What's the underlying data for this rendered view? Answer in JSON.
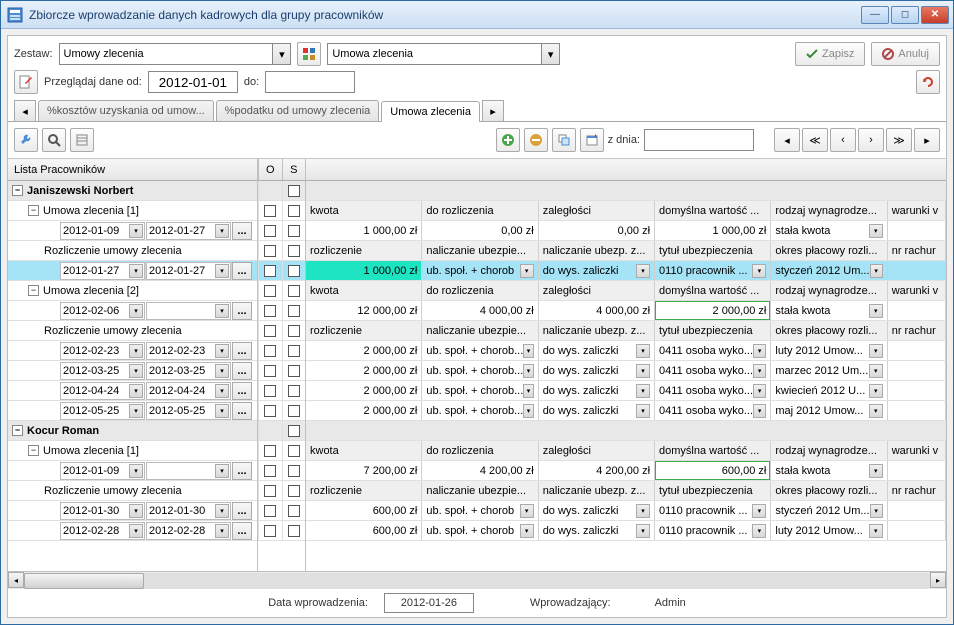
{
  "window": {
    "title": "Zbiorcze wprowadzanie danych kadrowych dla grupy pracowników"
  },
  "top": {
    "set_label": "Zestaw:",
    "set_value": "Umowy zlecenia",
    "set2_value": "Umowa zlecenia",
    "save": "Zapisz",
    "cancel": "Anuluj",
    "browse_label": "Przeglądaj dane od:",
    "date_from": "2012-01-01",
    "date_to_label": "do:",
    "date_to": ""
  },
  "tabs": {
    "items": [
      "%kosztów uzyskania od umow...",
      "%podatku od umowy zlecenia",
      "Umowa zlecenia"
    ],
    "active": 2
  },
  "toolbar": {
    "from_date_label": "z dnia:",
    "from_date": ""
  },
  "grid": {
    "left_header": "Lista Pracowników",
    "mid_headers": [
      "O",
      "S"
    ],
    "emp1": {
      "name": "Janiszewski Norbert"
    },
    "uz1": "Umowa zlecenia [1]",
    "uz1_hdr": [
      "kwota",
      "do rozliczenia",
      "zaległości",
      "domyślna wartość ...",
      "rodzaj wynagrodze...",
      "warunki v"
    ],
    "uz1_r1": {
      "d1": "2012-01-09",
      "d2": "2012-01-27",
      "c0": "1 000,00 zł",
      "c1": "0,00 zł",
      "c2": "0,00 zł",
      "c3": "1 000,00 zł",
      "c4": "stała kwota"
    },
    "ruz1_lbl": "Rozliczenie umowy zlecenia",
    "ruz1_hdr": [
      "rozliczenie",
      "naliczanie ubezpie...",
      "naliczanie ubezp. z...",
      "tytuł ubezpieczenia",
      "okres płacowy rozli...",
      "nr rachur"
    ],
    "ruz1_r1": {
      "d1": "2012-01-27",
      "d2": "2012-01-27",
      "c0": "1 000,00 zł",
      "c1": "ub. społ. + chorob",
      "c2": "do wys. zaliczki",
      "c3": "0110 pracownik ...",
      "c4": "styczeń 2012 Um..."
    },
    "uz2": "Umowa zlecenia [2]",
    "uz2_hdr": [
      "kwota",
      "do rozliczenia",
      "zaległości",
      "domyślna wartość ...",
      "rodzaj wynagrodze...",
      "warunki v"
    ],
    "uz2_r1": {
      "d1": "2012-02-06",
      "d2": "",
      "c0": "12 000,00 zł",
      "c1": "4 000,00 zł",
      "c2": "4 000,00 zł",
      "c3": "2 000,00 zł",
      "c4": "stała kwota"
    },
    "ruz2_lbl": "Rozliczenie umowy zlecenia",
    "ruz2_hdr": [
      "rozliczenie",
      "naliczanie ubezpie...",
      "naliczanie ubezp. z...",
      "tytuł ubezpieczenia",
      "okres płacowy rozli...",
      "nr rachur"
    ],
    "ruz2_rows": [
      {
        "d1": "2012-02-23",
        "d2": "2012-02-23",
        "c0": "2 000,00 zł",
        "c1": "ub. społ. + chorob...",
        "c2": "do wys. zaliczki",
        "c3": "0411 osoba wyko...",
        "c4": "luty 2012 Umow..."
      },
      {
        "d1": "2012-03-25",
        "d2": "2012-03-25",
        "c0": "2 000,00 zł",
        "c1": "ub. społ. + chorob...",
        "c2": "do wys. zaliczki",
        "c3": "0411 osoba wyko...",
        "c4": "marzec 2012 Um..."
      },
      {
        "d1": "2012-04-24",
        "d2": "2012-04-24",
        "c0": "2 000,00 zł",
        "c1": "ub. społ. + chorob...",
        "c2": "do wys. zaliczki",
        "c3": "0411 osoba wyko...",
        "c4": "kwiecień 2012 U..."
      },
      {
        "d1": "2012-05-25",
        "d2": "2012-05-25",
        "c0": "2 000,00 zł",
        "c1": "ub. społ. + chorob...",
        "c2": "do wys. zaliczki",
        "c3": "0411 osoba wyko...",
        "c4": "maj 2012 Umow..."
      }
    ],
    "emp2": {
      "name": "Kocur Roman"
    },
    "e2_uz1": "Umowa zlecenia [1]",
    "e2_uz1_hdr": [
      "kwota",
      "do rozliczenia",
      "zaległości",
      "domyślna wartość ...",
      "rodzaj wynagrodze...",
      "warunki v"
    ],
    "e2_uz1_r1": {
      "d1": "2012-01-09",
      "d2": "",
      "c0": "7 200,00 zł",
      "c1": "4 200,00 zł",
      "c2": "4 200,00 zł",
      "c3": "600,00 zł",
      "c4": "stała kwota"
    },
    "e2_ruz_lbl": "Rozliczenie umowy zlecenia",
    "e2_ruz_hdr": [
      "rozliczenie",
      "naliczanie ubezpie...",
      "naliczanie ubezp. z...",
      "tytuł ubezpieczenia",
      "okres płacowy rozli...",
      "nr rachur"
    ],
    "e2_ruz_rows": [
      {
        "d1": "2012-01-30",
        "d2": "2012-01-30",
        "c0": "600,00 zł",
        "c1": "ub. społ. + chorob",
        "c2": "do wys. zaliczki",
        "c3": "0110 pracownik ...",
        "c4": "styczeń 2012 Um..."
      },
      {
        "d1": "2012-02-28",
        "d2": "2012-02-28",
        "c0": "600,00 zł",
        "c1": "ub. społ. + chorob",
        "c2": "do wys. zaliczki",
        "c3": "0110 pracownik ...",
        "c4": "luty 2012 Umow..."
      }
    ]
  },
  "status": {
    "date_label": "Data wprowadzenia:",
    "date_value": "2012-01-26",
    "user_label": "Wprowadzający:",
    "user_value": "Admin"
  }
}
